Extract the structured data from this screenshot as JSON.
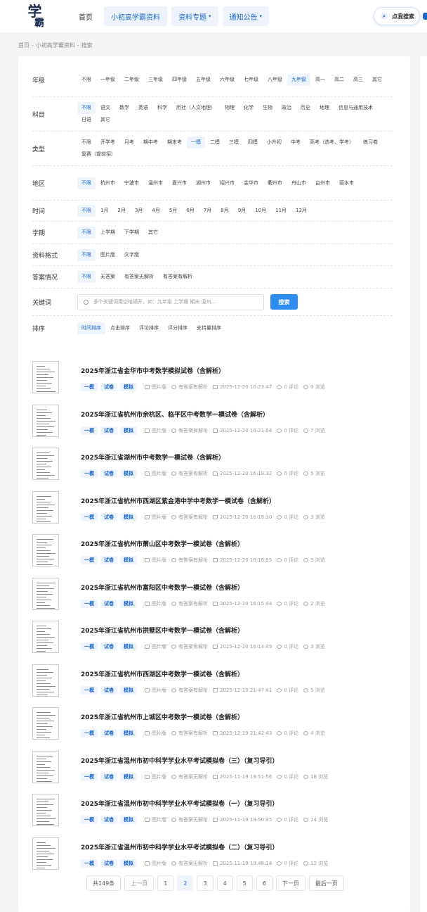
{
  "header": {
    "logo_text_1": "学",
    "logo_text_2": "霸",
    "nav": [
      {
        "label": "首页"
      },
      {
        "label": "小初高学霸资料"
      },
      {
        "label": "资料专题"
      },
      {
        "label": "通知公告"
      }
    ],
    "search_label": "点我搜索"
  },
  "breadcrumb": [
    "首页",
    "-",
    "小初高学霸资料",
    "-",
    "搜索"
  ],
  "filters": {
    "grade": {
      "label": "年级",
      "options": [
        "不限",
        "一年级",
        "二年级",
        "三年级",
        "四年级",
        "五年级",
        "六年级",
        "七年级",
        "八年级",
        "九年级",
        "高一",
        "高二",
        "高三",
        "其它"
      ],
      "selected": "九年级"
    },
    "subject": {
      "label": "科目",
      "options": [
        "不限",
        "语文",
        "数学",
        "英语",
        "科学",
        "历社（人文地理）",
        "物理",
        "化学",
        "生物",
        "政治",
        "历史",
        "地理",
        "信息与通用技术",
        "日语",
        "其它"
      ],
      "selected": "不限"
    },
    "type": {
      "label": "类型",
      "options": [
        "不限",
        "开学考",
        "月考",
        "期中考",
        "期末考",
        "一模",
        "二模",
        "三模",
        "四模",
        "小升初",
        "中考",
        "高考（选考、学考）",
        "练习卷",
        "复赛（提前招）"
      ],
      "selected": "一模"
    },
    "region": {
      "label": "地区",
      "options": [
        "不限",
        "杭州市",
        "宁波市",
        "温州市",
        "嘉兴市",
        "湖州市",
        "绍兴市",
        "金华市",
        "衢州市",
        "舟山市",
        "台州市",
        "丽水市"
      ],
      "selected": "不限"
    },
    "time": {
      "label": "时间",
      "options": [
        "不限",
        "1月",
        "2月",
        "3月",
        "4月",
        "5月",
        "6月",
        "7月",
        "8月",
        "9月",
        "10月",
        "11月",
        "12月"
      ],
      "selected": "不限"
    },
    "term": {
      "label": "学期",
      "options": [
        "不限",
        "上学期",
        "下学期",
        "其它"
      ],
      "selected": "不限"
    },
    "format": {
      "label": "资料格式",
      "options": [
        "不限",
        "图片版",
        "文字版"
      ],
      "selected": "不限"
    },
    "answer": {
      "label": "答案情况",
      "options": [
        "不限",
        "无答案",
        "有答案无解析",
        "有答案有解析"
      ],
      "selected": "不限"
    },
    "keyword": {
      "label": "关键词",
      "placeholder": "多个关键词用空格隔开，如：九年级 上学期 期末 温州...",
      "button": "搜索"
    },
    "sort": {
      "label": "排序",
      "options": [
        "时间排序",
        "点击排序",
        "评论排序",
        "评分排序",
        "支持量排序"
      ],
      "selected": "时间排序"
    }
  },
  "items": [
    {
      "title": "2025年浙江省金华市中考数学模拟试卷（含解析）",
      "tags": [
        "一模",
        "试卷",
        "模拟"
      ],
      "format": "图片版",
      "answer": "有答案有解析",
      "date": "2025-12-20 16:23:47",
      "comments": "0 评论",
      "views": "9 浏览"
    },
    {
      "title": "2025年浙江省杭州市余杭区、临平区中考数学一模试卷（含解析）",
      "tags": [
        "一模",
        "试卷",
        "模拟"
      ],
      "format": "图片版",
      "answer": "有答案有解析",
      "date": "2025-12-20 16:21:54",
      "comments": "0 评论",
      "views": "7 浏览"
    },
    {
      "title": "2025年浙江省湖州市中考数学一模试卷（含解析）",
      "tags": [
        "一模",
        "试卷",
        "模拟"
      ],
      "format": "图片版",
      "answer": "有答案有解析",
      "date": "2025-12-20 16:19:32",
      "comments": "0 评论",
      "views": "5 浏览"
    },
    {
      "title": "2025年浙江省杭州市西湖区紫金港中学中考数学一模试卷（含解析）",
      "tags": [
        "一模",
        "试卷",
        "模拟"
      ],
      "format": "图片版",
      "answer": "有答案有解析",
      "date": "2025-12-20 16:18:30",
      "comments": "0 评论",
      "views": "3 浏览"
    },
    {
      "title": "2025年浙江省杭州市萧山区中考数学一模试卷（含解析）",
      "tags": [
        "一模",
        "试卷",
        "模拟"
      ],
      "format": "图片版",
      "answer": "有答案有解析",
      "date": "2025-12-20 16:16:55",
      "comments": "0 评论",
      "views": "3 浏览"
    },
    {
      "title": "2025年浙江省杭州市富阳区中考数学一模试卷（含解析）",
      "tags": [
        "一模",
        "试卷",
        "模拟"
      ],
      "format": "图片版",
      "answer": "有答案有解析",
      "date": "2025-12-20 16:15:44",
      "comments": "0 评论",
      "views": "2 浏览"
    },
    {
      "title": "2025年浙江省杭州市拱墅区中考数学一模试卷（含解析）",
      "tags": [
        "一模",
        "试卷",
        "模拟"
      ],
      "format": "图片版",
      "answer": "有答案有解析",
      "date": "2025-12-20 16:14:49",
      "comments": "0 评论",
      "views": "3 浏览"
    },
    {
      "title": "2025年浙江省杭州市西湖区中考数学一模试卷（含解析）",
      "tags": [
        "一模",
        "试卷",
        "模拟"
      ],
      "format": "图片版",
      "answer": "有答案有解析",
      "date": "2025-12-19 21:47:41",
      "comments": "0 评论",
      "views": "5 浏览"
    },
    {
      "title": "2025年浙江省杭州市上城区中考数学一模试卷（含解析）",
      "tags": [
        "一模",
        "试卷",
        "模拟"
      ],
      "format": "图片版",
      "answer": "有答案有解析",
      "date": "2025-12-19 21:42:43",
      "comments": "0 评论",
      "views": "4 浏览"
    },
    {
      "title": "2025年浙江省温州市初中科学学业水平考试模拟卷（三）（复习导引）",
      "tags": [
        "一模",
        "试卷",
        "模拟"
      ],
      "format": "图片版",
      "answer": "有答案无解析",
      "date": "2025-11-19 19:51:56",
      "comments": "0 评论",
      "views": "18 浏览"
    },
    {
      "title": "2025年浙江省温州市初中科学学业水平考试模拟卷（一）（复习导引）",
      "tags": [
        "一模",
        "试卷",
        "模拟"
      ],
      "format": "图片版",
      "answer": "有答案无解析",
      "date": "2025-11-19 19:50:35",
      "comments": "0 评论",
      "views": "14 浏览"
    },
    {
      "title": "2025年浙江省温州市初中科学学业水平考试模拟卷（二）（复习导引）",
      "tags": [
        "一模",
        "试卷",
        "模拟"
      ],
      "format": "图片版",
      "answer": "有答案无解析",
      "date": "2025-11-19 19:48:14",
      "comments": "0 评论",
      "views": "12 浏览"
    }
  ],
  "pagination": {
    "total": "共149条",
    "prev": "上一页",
    "pages": [
      "1",
      "2",
      "3",
      "4",
      "5",
      "6"
    ],
    "current": "2",
    "next": "下一页",
    "last": "最后一页"
  }
}
